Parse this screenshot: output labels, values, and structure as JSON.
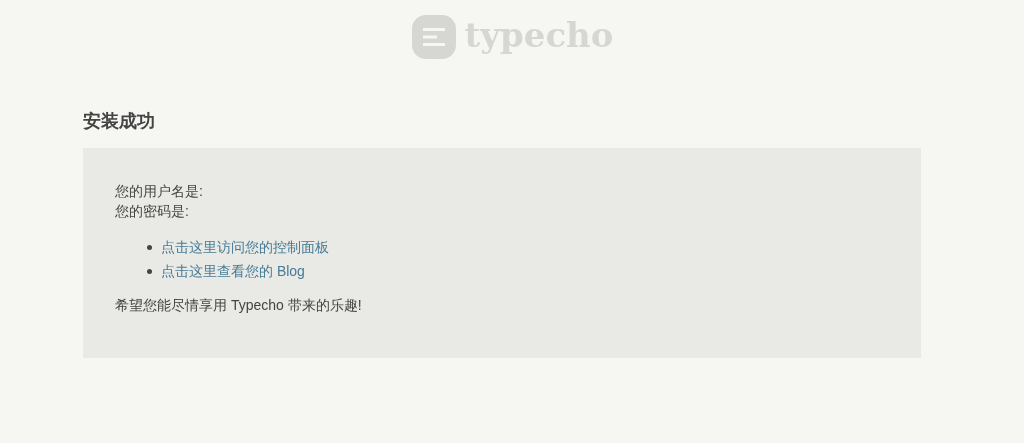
{
  "logo": {
    "wordmark": "typecho"
  },
  "heading": "安装成功",
  "credentials": [
    {
      "label": "您的用户名是:"
    },
    {
      "label": "您的密码是:"
    }
  ],
  "links": [
    {
      "text": "点击这里访问您的控制面板"
    },
    {
      "text": "点击这里查看您的 Blog"
    }
  ],
  "message": "希望您能尽情享用 Typecho 带来的乐趣!"
}
